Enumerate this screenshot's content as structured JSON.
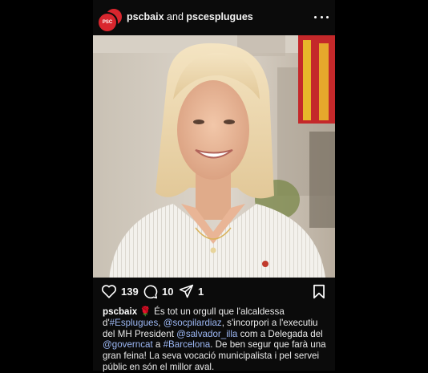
{
  "header": {
    "account": "pscbaix",
    "separator": " and ",
    "collaborator": "pscesplugues",
    "avatar_text": "PSC"
  },
  "actions": {
    "likes": "139",
    "comments": "10",
    "shares": "1"
  },
  "caption": {
    "username": "pscbaix",
    "rose": "🌹",
    "t1": " És tot un orgull que l'alcaldessa d'",
    "h1": "#Esplugues",
    "t2": ", ",
    "m1": "@socpilardiaz",
    "t3": ", s'incorpori a l'executiu del MH President ",
    "m2": "@salvador_illa",
    "t4": " com a Delegada del ",
    "m3": "@governcat",
    "t5": " a ",
    "h2": "#Barcelona",
    "t6": ". De ben segur que farà una gran feina! La seva vocació municipalista i pel servei públic en són el millor aval."
  },
  "colors": {
    "brand_red": "#d9262e",
    "link": "#9db8f5",
    "background": "#000000"
  },
  "icons": [
    "heart-icon",
    "comment-icon",
    "share-icon",
    "bookmark-icon",
    "more-icon"
  ]
}
